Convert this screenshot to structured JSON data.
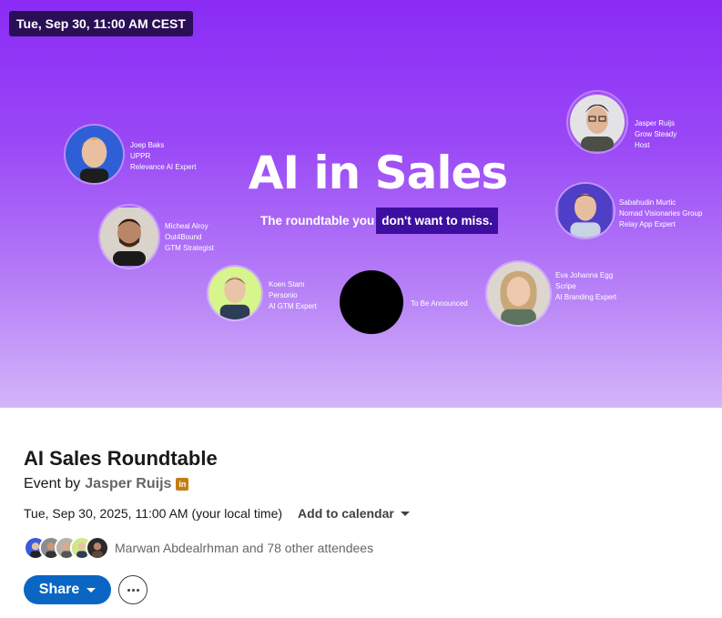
{
  "banner": {
    "date_chip": "Tue, Sep 30, 11:00 AM CEST",
    "title": "AI in Sales",
    "tagline_plain": "The roundtable you",
    "tagline_highlight": "don't want to miss.",
    "speakers": [
      {
        "name": "Joep Baks",
        "company": "UPPR",
        "role": "Relevance AI Expert",
        "photo": "person-photo"
      },
      {
        "name": "Micheal Alroy",
        "company": "Out4Bound",
        "role": "GTM Strategist",
        "photo": "person-photo"
      },
      {
        "name": "Koen Stam",
        "company": "Personio",
        "role": "AI GTM Expert",
        "photo": "person-photo"
      },
      {
        "name": "To Be Announced",
        "photo": "black-circle"
      },
      {
        "name": "Eva Johanna Egg",
        "company": "Scripe",
        "role": "AI Branding Expert",
        "photo": "person-photo"
      },
      {
        "name": "Sabahudin Murtic",
        "company": "Nomad Visionaries Group",
        "role": "Relay App Expert",
        "photo": "person-photo"
      },
      {
        "name": "Jasper Ruijs",
        "company": "Grow Steady",
        "role": "Host",
        "photo": "person-photo"
      }
    ],
    "colors": {
      "gradient_top": "#8a2bf5",
      "gradient_bottom": "#d3b6f8",
      "highlight": "#3d0fa0",
      "chip": "#2a0f57"
    }
  },
  "event": {
    "title": "AI Sales Roundtable",
    "by_label": "Event by",
    "organizer": "Jasper Ruijs",
    "organizer_badge": "in",
    "datetime": "Tue, Sep 30, 2025, 11:00 AM (your local time)",
    "add_to_calendar": "Add to calendar",
    "attendees_text": "Marwan Abdealrhman and 78 other attendees",
    "share_label": "Share",
    "more_icon": "ellipsis-icon",
    "accent_color": "#0a66c2"
  }
}
